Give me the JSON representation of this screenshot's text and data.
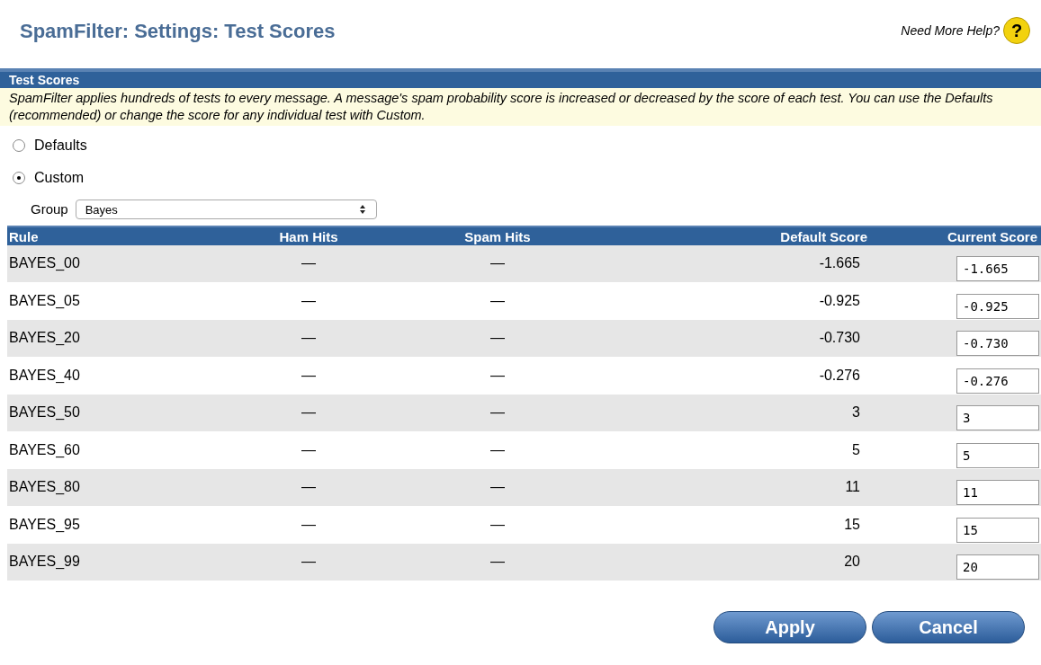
{
  "page_title": "SpamFilter: Settings: Test Scores",
  "help": {
    "label": "Need More Help?",
    "icon": "?"
  },
  "section": {
    "title": "Test Scores",
    "description": "SpamFilter applies hundreds of tests to every message. A message's spam probability score is increased or decreased by the score of each test. You can use the Defaults (recommended) or change the score for any individual test with Custom."
  },
  "options": [
    {
      "label": "Defaults",
      "selected": false
    },
    {
      "label": "Custom",
      "selected": true
    }
  ],
  "group": {
    "label": "Group",
    "value": "Bayes"
  },
  "table": {
    "columns": [
      "Rule",
      "Ham Hits",
      "Spam Hits",
      "Default Score",
      "Current Score"
    ],
    "rows": [
      {
        "rule": "BAYES_00",
        "ham": "—",
        "spam": "—",
        "default": "-1.665",
        "current": "-1.665"
      },
      {
        "rule": "BAYES_05",
        "ham": "—",
        "spam": "—",
        "default": "-0.925",
        "current": "-0.925"
      },
      {
        "rule": "BAYES_20",
        "ham": "—",
        "spam": "—",
        "default": "-0.730",
        "current": "-0.730"
      },
      {
        "rule": "BAYES_40",
        "ham": "—",
        "spam": "—",
        "default": "-0.276",
        "current": "-0.276"
      },
      {
        "rule": "BAYES_50",
        "ham": "—",
        "spam": "—",
        "default": "3",
        "current": "3"
      },
      {
        "rule": "BAYES_60",
        "ham": "—",
        "spam": "—",
        "default": "5",
        "current": "5"
      },
      {
        "rule": "BAYES_80",
        "ham": "—",
        "spam": "—",
        "default": "11",
        "current": "11"
      },
      {
        "rule": "BAYES_95",
        "ham": "—",
        "spam": "—",
        "default": "15",
        "current": "15"
      },
      {
        "rule": "BAYES_99",
        "ham": "—",
        "spam": "—",
        "default": "20",
        "current": "20"
      }
    ]
  },
  "buttons": [
    "Apply",
    "Cancel"
  ]
}
